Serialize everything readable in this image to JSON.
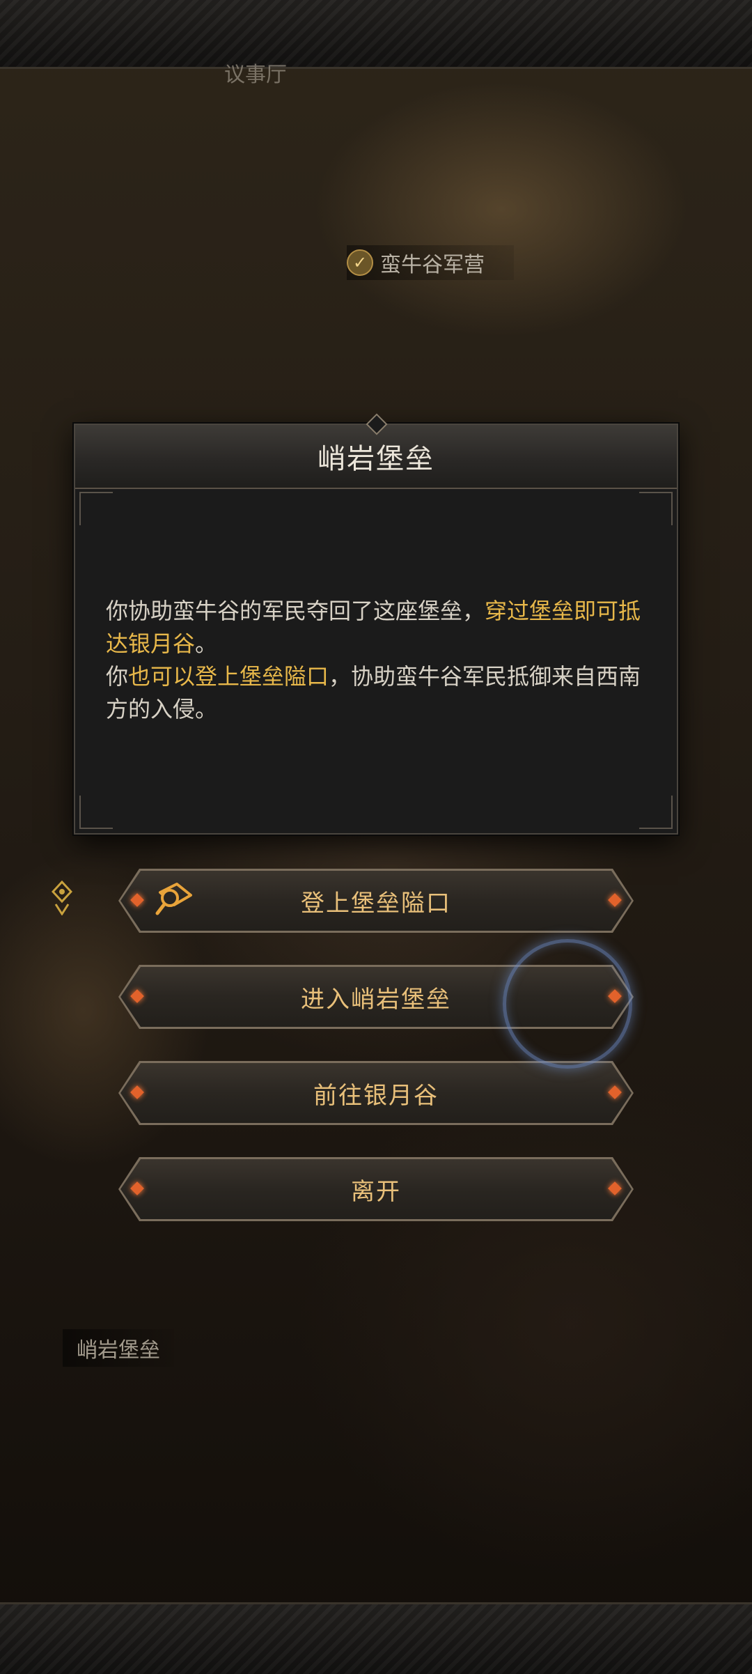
{
  "map": {
    "hall_label": "议事厅",
    "camp_label": "蛮牛谷军营",
    "current_location": "峭岩堡垒"
  },
  "dialog": {
    "title": "峭岩堡垒",
    "p1_a": "你协助蛮牛谷的军民夺回了这座堡垒，",
    "p1_hl": "穿过堡垒即可抵达银月谷",
    "p1_b": "。",
    "p2_a": "你",
    "p2_hl": "也可以登上堡垒隘口",
    "p2_b": "，协助蛮牛谷军民抵御来自西南方的入侵。"
  },
  "options": [
    {
      "label": "登上堡垒隘口",
      "icon": "map-search-icon"
    },
    {
      "label": "进入峭岩堡垒"
    },
    {
      "label": "前往银月谷"
    },
    {
      "label": "离开"
    }
  ],
  "colors": {
    "highlight": "#e8b84a",
    "button_text": "#e9c07a",
    "gem": "#e2622b"
  }
}
